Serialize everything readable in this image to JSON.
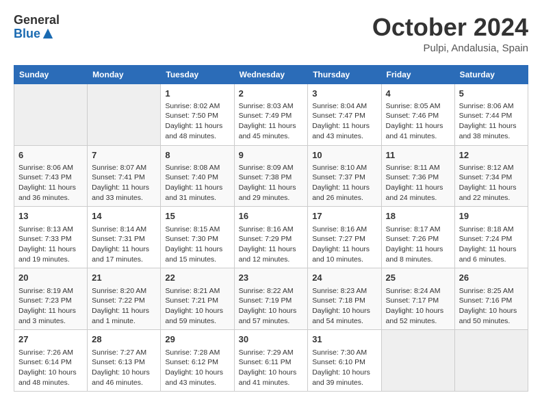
{
  "header": {
    "logo_general": "General",
    "logo_blue": "Blue",
    "month_title": "October 2024",
    "location": "Pulpi, Andalusia, Spain"
  },
  "days_of_week": [
    "Sunday",
    "Monday",
    "Tuesday",
    "Wednesday",
    "Thursday",
    "Friday",
    "Saturday"
  ],
  "weeks": [
    [
      {
        "day": "",
        "empty": true
      },
      {
        "day": "",
        "empty": true
      },
      {
        "day": "1",
        "sunrise": "Sunrise: 8:02 AM",
        "sunset": "Sunset: 7:50 PM",
        "daylight": "Daylight: 11 hours and 48 minutes."
      },
      {
        "day": "2",
        "sunrise": "Sunrise: 8:03 AM",
        "sunset": "Sunset: 7:49 PM",
        "daylight": "Daylight: 11 hours and 45 minutes."
      },
      {
        "day": "3",
        "sunrise": "Sunrise: 8:04 AM",
        "sunset": "Sunset: 7:47 PM",
        "daylight": "Daylight: 11 hours and 43 minutes."
      },
      {
        "day": "4",
        "sunrise": "Sunrise: 8:05 AM",
        "sunset": "Sunset: 7:46 PM",
        "daylight": "Daylight: 11 hours and 41 minutes."
      },
      {
        "day": "5",
        "sunrise": "Sunrise: 8:06 AM",
        "sunset": "Sunset: 7:44 PM",
        "daylight": "Daylight: 11 hours and 38 minutes."
      }
    ],
    [
      {
        "day": "6",
        "sunrise": "Sunrise: 8:06 AM",
        "sunset": "Sunset: 7:43 PM",
        "daylight": "Daylight: 11 hours and 36 minutes."
      },
      {
        "day": "7",
        "sunrise": "Sunrise: 8:07 AM",
        "sunset": "Sunset: 7:41 PM",
        "daylight": "Daylight: 11 hours and 33 minutes."
      },
      {
        "day": "8",
        "sunrise": "Sunrise: 8:08 AM",
        "sunset": "Sunset: 7:40 PM",
        "daylight": "Daylight: 11 hours and 31 minutes."
      },
      {
        "day": "9",
        "sunrise": "Sunrise: 8:09 AM",
        "sunset": "Sunset: 7:38 PM",
        "daylight": "Daylight: 11 hours and 29 minutes."
      },
      {
        "day": "10",
        "sunrise": "Sunrise: 8:10 AM",
        "sunset": "Sunset: 7:37 PM",
        "daylight": "Daylight: 11 hours and 26 minutes."
      },
      {
        "day": "11",
        "sunrise": "Sunrise: 8:11 AM",
        "sunset": "Sunset: 7:36 PM",
        "daylight": "Daylight: 11 hours and 24 minutes."
      },
      {
        "day": "12",
        "sunrise": "Sunrise: 8:12 AM",
        "sunset": "Sunset: 7:34 PM",
        "daylight": "Daylight: 11 hours and 22 minutes."
      }
    ],
    [
      {
        "day": "13",
        "sunrise": "Sunrise: 8:13 AM",
        "sunset": "Sunset: 7:33 PM",
        "daylight": "Daylight: 11 hours and 19 minutes."
      },
      {
        "day": "14",
        "sunrise": "Sunrise: 8:14 AM",
        "sunset": "Sunset: 7:31 PM",
        "daylight": "Daylight: 11 hours and 17 minutes."
      },
      {
        "day": "15",
        "sunrise": "Sunrise: 8:15 AM",
        "sunset": "Sunset: 7:30 PM",
        "daylight": "Daylight: 11 hours and 15 minutes."
      },
      {
        "day": "16",
        "sunrise": "Sunrise: 8:16 AM",
        "sunset": "Sunset: 7:29 PM",
        "daylight": "Daylight: 11 hours and 12 minutes."
      },
      {
        "day": "17",
        "sunrise": "Sunrise: 8:16 AM",
        "sunset": "Sunset: 7:27 PM",
        "daylight": "Daylight: 11 hours and 10 minutes."
      },
      {
        "day": "18",
        "sunrise": "Sunrise: 8:17 AM",
        "sunset": "Sunset: 7:26 PM",
        "daylight": "Daylight: 11 hours and 8 minutes."
      },
      {
        "day": "19",
        "sunrise": "Sunrise: 8:18 AM",
        "sunset": "Sunset: 7:24 PM",
        "daylight": "Daylight: 11 hours and 6 minutes."
      }
    ],
    [
      {
        "day": "20",
        "sunrise": "Sunrise: 8:19 AM",
        "sunset": "Sunset: 7:23 PM",
        "daylight": "Daylight: 11 hours and 3 minutes."
      },
      {
        "day": "21",
        "sunrise": "Sunrise: 8:20 AM",
        "sunset": "Sunset: 7:22 PM",
        "daylight": "Daylight: 11 hours and 1 minute."
      },
      {
        "day": "22",
        "sunrise": "Sunrise: 8:21 AM",
        "sunset": "Sunset: 7:21 PM",
        "daylight": "Daylight: 10 hours and 59 minutes."
      },
      {
        "day": "23",
        "sunrise": "Sunrise: 8:22 AM",
        "sunset": "Sunset: 7:19 PM",
        "daylight": "Daylight: 10 hours and 57 minutes."
      },
      {
        "day": "24",
        "sunrise": "Sunrise: 8:23 AM",
        "sunset": "Sunset: 7:18 PM",
        "daylight": "Daylight: 10 hours and 54 minutes."
      },
      {
        "day": "25",
        "sunrise": "Sunrise: 8:24 AM",
        "sunset": "Sunset: 7:17 PM",
        "daylight": "Daylight: 10 hours and 52 minutes."
      },
      {
        "day": "26",
        "sunrise": "Sunrise: 8:25 AM",
        "sunset": "Sunset: 7:16 PM",
        "daylight": "Daylight: 10 hours and 50 minutes."
      }
    ],
    [
      {
        "day": "27",
        "sunrise": "Sunrise: 7:26 AM",
        "sunset": "Sunset: 6:14 PM",
        "daylight": "Daylight: 10 hours and 48 minutes."
      },
      {
        "day": "28",
        "sunrise": "Sunrise: 7:27 AM",
        "sunset": "Sunset: 6:13 PM",
        "daylight": "Daylight: 10 hours and 46 minutes."
      },
      {
        "day": "29",
        "sunrise": "Sunrise: 7:28 AM",
        "sunset": "Sunset: 6:12 PM",
        "daylight": "Daylight: 10 hours and 43 minutes."
      },
      {
        "day": "30",
        "sunrise": "Sunrise: 7:29 AM",
        "sunset": "Sunset: 6:11 PM",
        "daylight": "Daylight: 10 hours and 41 minutes."
      },
      {
        "day": "31",
        "sunrise": "Sunrise: 7:30 AM",
        "sunset": "Sunset: 6:10 PM",
        "daylight": "Daylight: 10 hours and 39 minutes."
      },
      {
        "day": "",
        "empty": true
      },
      {
        "day": "",
        "empty": true
      }
    ]
  ]
}
